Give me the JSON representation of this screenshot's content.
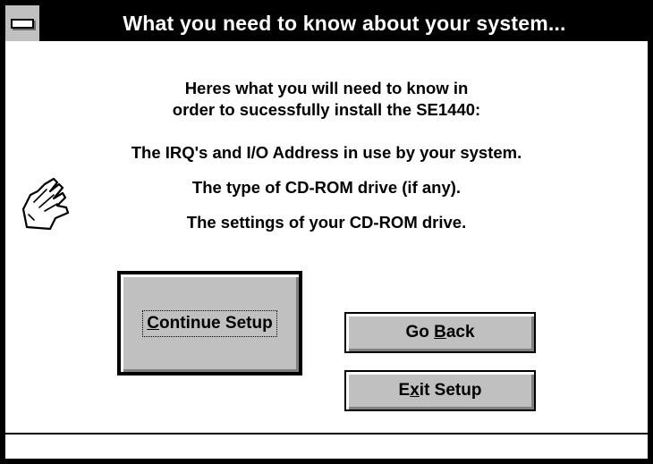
{
  "window": {
    "title": "What you need to know about your system..."
  },
  "content": {
    "intro_line1": "Heres what you will need to know in",
    "intro_line2": "order to sucessfully install the SE1440:",
    "requirements": [
      "The IRQ's and I/O Address in use by your system.",
      "The type of CD-ROM drive (if any).",
      "The settings of your CD-ROM drive."
    ]
  },
  "buttons": {
    "continue": {
      "mnemonic": "C",
      "rest": "ontinue Setup"
    },
    "go_back": {
      "pre": "Go ",
      "mnemonic": "B",
      "rest": "ack"
    },
    "exit": {
      "pre": "E",
      "mnemonic": "x",
      "rest": "it Setup"
    }
  },
  "icons": {
    "hand": "pointing-hand-icon",
    "system_menu": "system-menu-icon"
  },
  "colors": {
    "titlebar": "#000000",
    "button_face": "#c0c0c0",
    "background": "#ffffff"
  }
}
